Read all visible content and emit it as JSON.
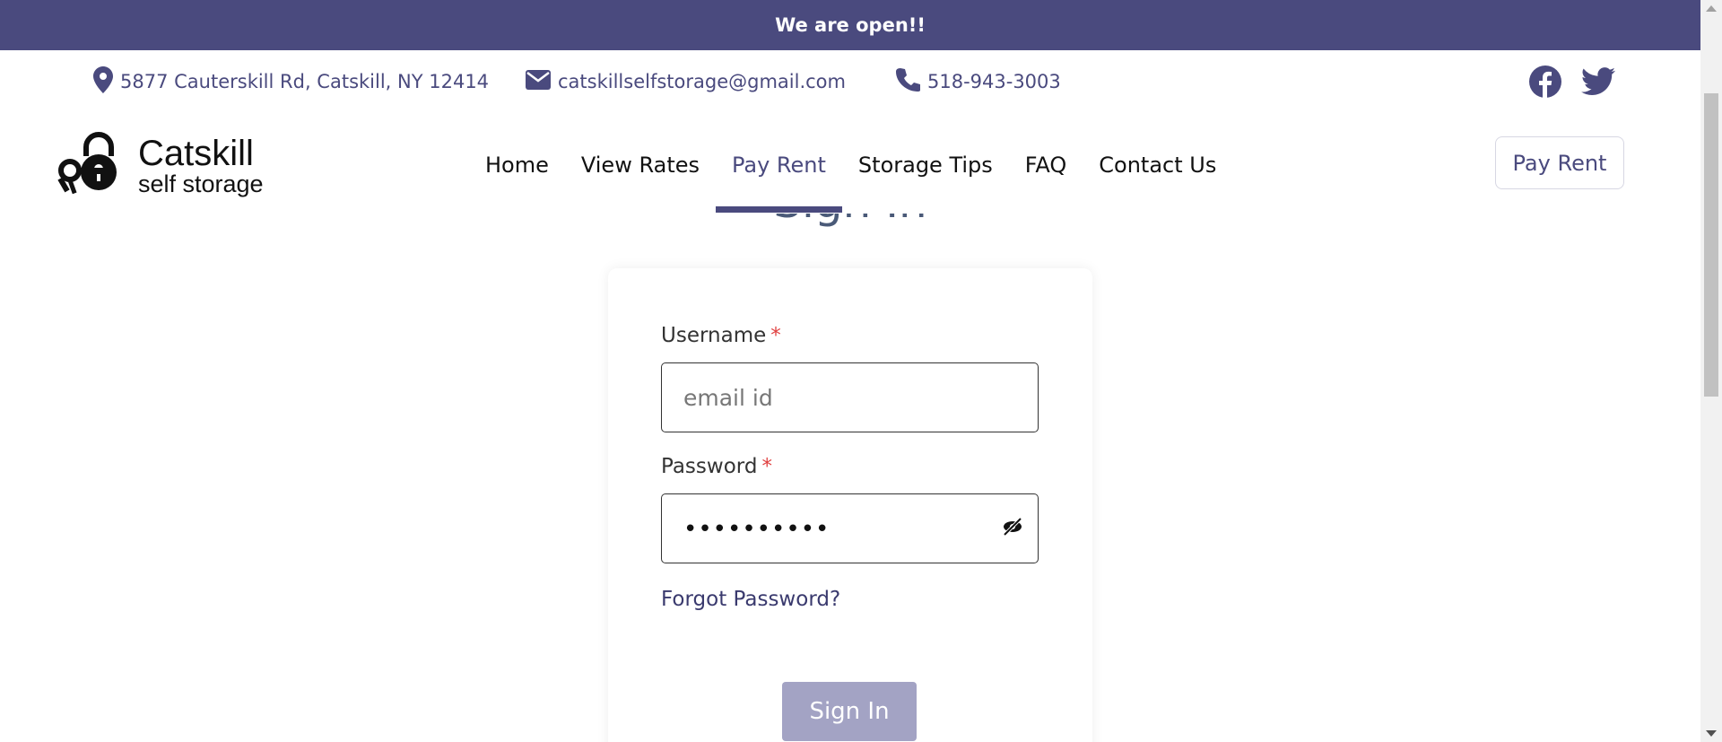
{
  "announcement": {
    "text": "We are open!!"
  },
  "contact": {
    "address": "5877 Cauterskill Rd, Catskill, NY 12414",
    "email": "catskillselfstorage@gmail.com",
    "phone": "518-943-3003",
    "icons": {
      "address": "map-pin-icon",
      "email": "envelope-icon",
      "phone": "phone-icon"
    }
  },
  "social": {
    "facebook": "facebook-icon",
    "twitter": "twitter-icon"
  },
  "logo": {
    "title": "Catskill",
    "subtitle": "self storage",
    "icon": "padlock-keys-icon"
  },
  "nav": {
    "items": [
      {
        "label": "Home"
      },
      {
        "label": "View Rates"
      },
      {
        "label": "Pay Rent",
        "active": true
      },
      {
        "label": "Storage Tips"
      },
      {
        "label": "FAQ"
      },
      {
        "label": "Contact Us"
      }
    ]
  },
  "header_button": {
    "label": "Pay Rent"
  },
  "page": {
    "heading": "Sign In"
  },
  "form": {
    "username": {
      "label": "Username",
      "required_mark": "*",
      "placeholder": "email id",
      "value": ""
    },
    "password": {
      "label": "Password",
      "required_mark": "*",
      "masked_value": "••••••••••",
      "toggle_icon": "eye-slash-icon"
    },
    "forgot_link": "Forgot Password?",
    "submit_label": "Sign In"
  },
  "colors": {
    "brand": "#4a4a7e",
    "button_disabled": "#a3a3c4",
    "required": "#e04040"
  }
}
